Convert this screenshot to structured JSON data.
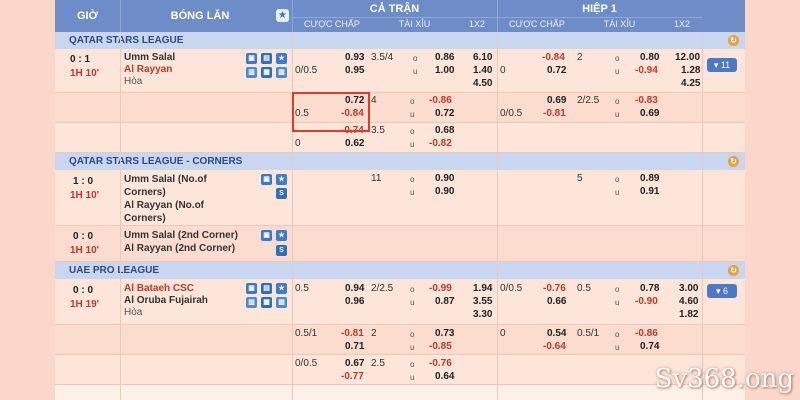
{
  "header": {
    "time": "GIỜ",
    "match": "BÓNG LĂN",
    "full_match": "CẢ TRẬN",
    "first_half": "HIỆP 1",
    "handicap": "CƯỢC CHẤP",
    "over_under": "TÀI XỈU",
    "one_x_two": "1X2",
    "handicap_h1": "CƯỢC CHẤP",
    "over_under_h1": "TÀI XỈU",
    "one_x_two_h1": "1X2"
  },
  "leagues": [
    {
      "name": "QATAR STARS LEAGUE",
      "match": {
        "score": "0 : 1",
        "time": "1H 10'",
        "home": "Umm Salal",
        "away": "Al Rayyan",
        "draw": "Hòa",
        "more": "▾ 11",
        "rows": [
          {
            "hc": "0/0.5",
            "hc_home": "0.93",
            "hc_away": "0.95",
            "ou_line": "3.5/4",
            "ou_o": "o",
            "ou_u": "u",
            "ou_over": "0.86",
            "ou_under": "1.00",
            "x1": "6.10",
            "x2": "1.40",
            "x3": "4.50",
            "h1_hc": "0",
            "h1_home": "-0.84",
            "h1_away": "0.72",
            "h1_ou_line": "2",
            "h1_over": "0.80",
            "h1_under": "-0.94",
            "h1_x1": "12.00",
            "h1_x2": "1.28",
            "h1_x3": "4.25"
          },
          {
            "hc": "0.5",
            "hc_home": "0.72",
            "hc_away": "-0.84",
            "ou_line": "4",
            "ou_over": "-0.86",
            "ou_under": "0.72",
            "h1_hc": "0/0.5",
            "h1_home": "0.69",
            "h1_away": "-0.81",
            "h1_ou_line": "2/2.5",
            "h1_over": "-0.83",
            "h1_under": "0.69"
          },
          {
            "hc": "0",
            "hc_home": "-0.74",
            "hc_away": "0.62",
            "ou_line": "3.5",
            "ou_over": "0.68",
            "ou_under": "-0.82"
          }
        ]
      }
    },
    {
      "name": "QATAR STARS LEAGUE - CORNERS",
      "matches": [
        {
          "score": "1 : 0",
          "time": "1H 10'",
          "home": "Umm Salal (No.of Corners)",
          "away": "Al Rayyan (No.of Corners)",
          "ou_line": "11",
          "ou_over": "0.90",
          "ou_under": "0.90",
          "h1_ou_line": "5",
          "h1_over": "0.89",
          "h1_under": "0.91"
        },
        {
          "score": "0 : 0",
          "time": "1H 10'",
          "home": "Umm Salal (2nd Corner)",
          "away": "Al Rayyan (2nd Corner)"
        }
      ]
    },
    {
      "name": "UAE PRO LEAGUE",
      "match": {
        "score": "0 : 0",
        "time": "1H 19'",
        "home": "Al Bataeh CSC",
        "away": "Al Oruba Fujairah",
        "draw": "Hòa",
        "more": "▾ 6",
        "rows": [
          {
            "hc": "0.5",
            "hc_home": "0.94",
            "hc_away": "0.96",
            "ou_line": "2/2.5",
            "ou_over": "-0.99",
            "ou_under": "0.87",
            "x1": "1.94",
            "x2": "3.55",
            "x3": "3.30",
            "h1_hc": "0/0.5",
            "h1_home": "-0.76",
            "h1_away": "0.66",
            "h1_ou_line": "0.5",
            "h1_over": "0.78",
            "h1_under": "-0.90",
            "h1_x1": "3.00",
            "h1_x2": "4.60",
            "h1_x3": "1.82"
          },
          {
            "hc": "0.5/1",
            "hc_home": "-0.81",
            "hc_away": "0.71",
            "ou_line": "2",
            "ou_over": "0.73",
            "ou_under": "-0.85",
            "h1_hc": "0",
            "h1_home": "0.54",
            "h1_away": "-0.64",
            "h1_ou_line": "0.5/1",
            "h1_over": "-0.86",
            "h1_under": "0.74"
          },
          {
            "hc": "0/0.5",
            "hc_home": "0.67",
            "hc_away": "-0.77",
            "ou_line": "2.5",
            "ou_over": "-0.76",
            "ou_under": "0.64"
          }
        ]
      }
    }
  ],
  "ou_labels": {
    "o": "o",
    "u": "u"
  },
  "icons": {
    "tv": "TV",
    "stats": "▤",
    "fav": "★",
    "s": "S"
  },
  "watermark": "Sv368.ong"
}
